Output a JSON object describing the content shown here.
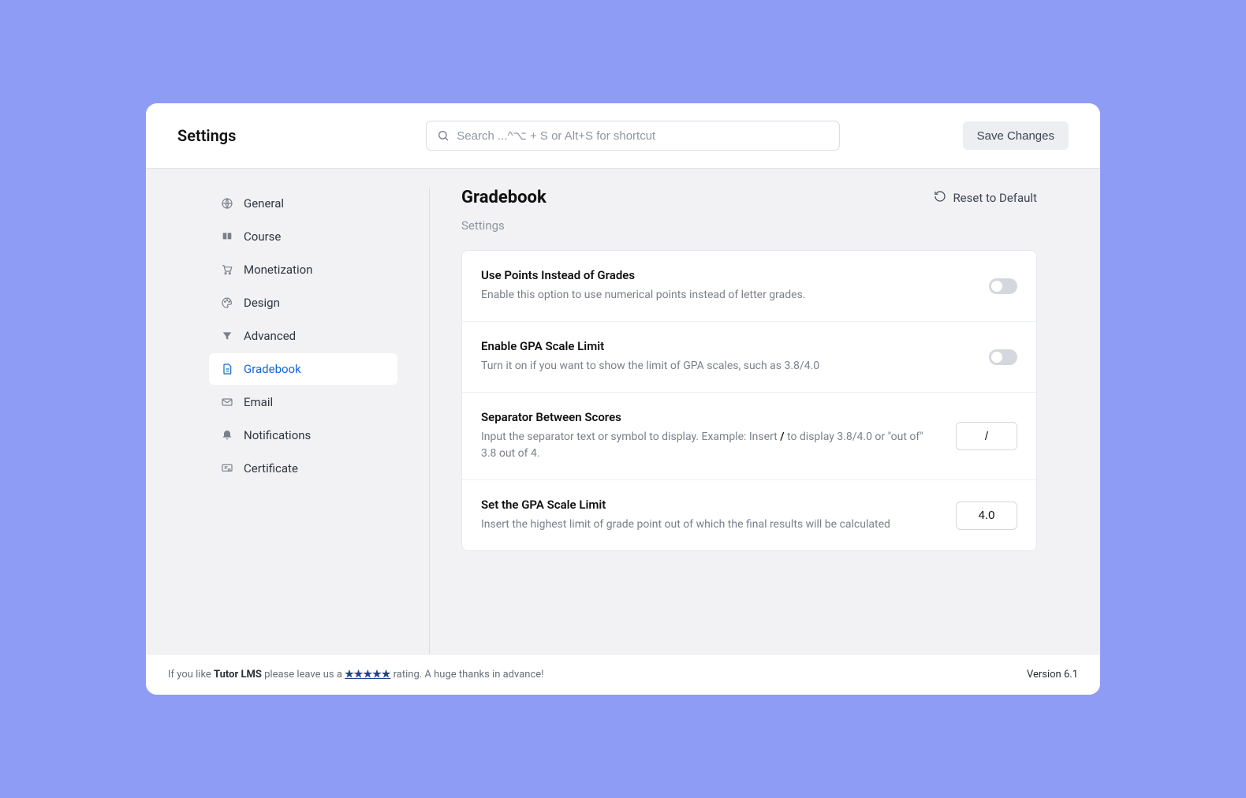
{
  "page_title": "Settings",
  "search": {
    "placeholder": "Search ...^⌥ + S or Alt+S for shortcut"
  },
  "save_button_label": "Save Changes",
  "sidebar": {
    "active_index": 5,
    "items": [
      {
        "label": "General",
        "icon": "globe-icon"
      },
      {
        "label": "Course",
        "icon": "book-icon"
      },
      {
        "label": "Monetization",
        "icon": "cart-icon"
      },
      {
        "label": "Design",
        "icon": "palette-icon"
      },
      {
        "label": "Advanced",
        "icon": "filter-icon"
      },
      {
        "label": "Gradebook",
        "icon": "doc-icon"
      },
      {
        "label": "Email",
        "icon": "mail-icon"
      },
      {
        "label": "Notifications",
        "icon": "bell-icon"
      },
      {
        "label": "Certificate",
        "icon": "certificate-icon"
      }
    ]
  },
  "main": {
    "title": "Gradebook",
    "reset_label": "Reset to Default",
    "subhead": "Settings",
    "rows": [
      {
        "title": "Use Points Instead of Grades",
        "desc": "Enable this option to use numerical points instead of letter grades.",
        "type": "toggle",
        "value": false
      },
      {
        "title": "Enable GPA Scale Limit",
        "desc": "Turn it on if you want to show the limit of GPA scales, such as 3.8/4.0",
        "type": "toggle",
        "value": false
      },
      {
        "title": "Separator Between Scores",
        "desc_pre": "Input the separator text or symbol to display. Example: Insert ",
        "desc_em": "/",
        "desc_post": " to display 3.8/4.0 or \"out of\" 3.8 out of 4.",
        "type": "input",
        "value": "/"
      },
      {
        "title": "Set the GPA Scale Limit",
        "desc": "Insert the highest limit of grade point out of which the final results will be calculated",
        "type": "input",
        "value": "4.0"
      }
    ]
  },
  "footer": {
    "prefix": "If you like ",
    "brand": "Tutor LMS",
    "mid": " please leave us a ",
    "stars": "★★★★★",
    "suffix": " rating. A huge thanks in advance!",
    "version": "Version 6.1"
  }
}
